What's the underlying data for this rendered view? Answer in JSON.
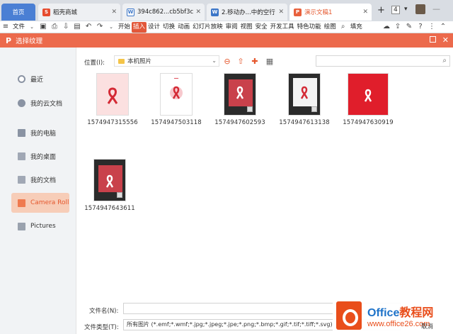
{
  "tabs": [
    {
      "label": "首页"
    },
    {
      "label": "稻壳商城"
    },
    {
      "label": "394c862...cb5bf3c"
    },
    {
      "label": "2.移动办...中的空行"
    },
    {
      "label": "演示文稿1"
    }
  ],
  "tab_count": "4",
  "ribbon": {
    "file_menu": "文件",
    "items": [
      "开始",
      "插入",
      "设计",
      "切换",
      "动画",
      "幻灯片放映",
      "审阅",
      "视图",
      "安全",
      "开发工具",
      "特色功能",
      "绘图"
    ],
    "active_item": "插入",
    "fill_label": "填充"
  },
  "dialog": {
    "title": "选择纹理",
    "sidebar": [
      {
        "label": "最近",
        "icon": "clock-icon"
      },
      {
        "label": "我的云文档",
        "icon": "cloud-icon"
      },
      {
        "label": "我的电脑",
        "icon": "computer-icon"
      },
      {
        "label": "我的桌面",
        "icon": "folder-icon"
      },
      {
        "label": "我的文档",
        "icon": "folder-icon"
      },
      {
        "label": "Camera Roll",
        "icon": "folder-icon",
        "active": true
      },
      {
        "label": "Pictures",
        "icon": "folder-icon"
      }
    ],
    "location_label": "位置(I):",
    "location_value": "本机照片",
    "files": [
      {
        "name": "1574947315556"
      },
      {
        "name": "1574947503118"
      },
      {
        "name": "1574947602593"
      },
      {
        "name": "1574947613138"
      },
      {
        "name": "1574947630919"
      },
      {
        "name": "1574947643611"
      }
    ],
    "filename_label": "文件名(N):",
    "filename_value": "",
    "filetype_label": "文件类型(T):",
    "filetype_value": "所有图片 (*.emf;*.wmf;*.jpg;*.jpeg;*.jpe;*.png;*.bmp;*.gif;*.tif;*.tiff;*.svg)",
    "cancel_label": "取消"
  },
  "watermark": {
    "title_en": "Office",
    "title_cn": "教程网",
    "url": "www.office26.com"
  },
  "colors": {
    "accent": "#ec6a4c",
    "active_bg": "#f7cdb8",
    "tab_home": "#4a7fd4"
  }
}
